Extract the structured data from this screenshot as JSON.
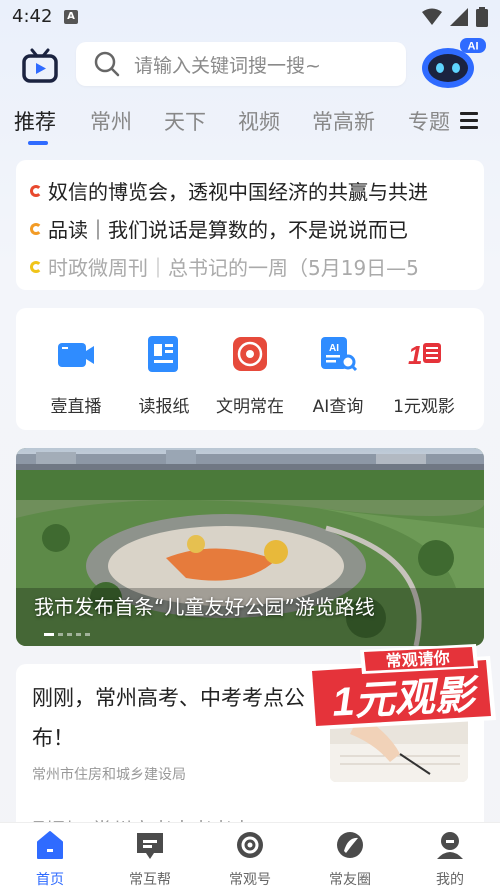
{
  "status": {
    "time": "4:42",
    "a_badge": "A"
  },
  "header": {
    "search_placeholder": "请输入关键词搜一搜~",
    "ai_badge": "AI"
  },
  "tabs": [
    {
      "label": "推荐",
      "active": true
    },
    {
      "label": "常州"
    },
    {
      "label": "天下"
    },
    {
      "label": "视频"
    },
    {
      "label": "常高新"
    },
    {
      "label": "专题"
    }
  ],
  "headlines": [
    {
      "text": "奴信的博览会，透视中国经济的共赢与共进",
      "color": "#e8492e",
      "muted": false
    },
    {
      "text": "品读｜我们说话是算数的，不是说说而已",
      "color": "#f29b26",
      "muted": false
    },
    {
      "text": "时政微周刊｜总书记的一周（5月19日—5",
      "color": "#f0c419",
      "muted": true
    }
  ],
  "quick": [
    {
      "label": "壹直播",
      "icon": "live-camera-icon"
    },
    {
      "label": "读报纸",
      "icon": "newspaper-icon"
    },
    {
      "label": "文明常在",
      "icon": "civilization-icon"
    },
    {
      "label": "AI查询",
      "icon": "ai-search-icon"
    },
    {
      "label": "1元观影",
      "icon": "one-yuan-movie-icon"
    }
  ],
  "banner": {
    "caption": "我市发布首条“儿童友好公园”游览路线"
  },
  "article": {
    "title": "刚刚，常州高考、中考考点公布！",
    "source": "常州市住房和城乡建设局",
    "peek": "刚刚，常州高考中考考点"
  },
  "promo": {
    "top": "常观请你",
    "big": "1元观影"
  },
  "nav": [
    {
      "label": "首页",
      "active": true,
      "icon": "home-icon"
    },
    {
      "label": "常互帮",
      "icon": "help-chat-icon"
    },
    {
      "label": "常观号",
      "icon": "channel-icon"
    },
    {
      "label": "常友圈",
      "icon": "circle-icon"
    },
    {
      "label": "我的",
      "icon": "profile-icon"
    }
  ],
  "colors": {
    "accent": "#2f6bff",
    "promo_red": "#e5333a"
  }
}
